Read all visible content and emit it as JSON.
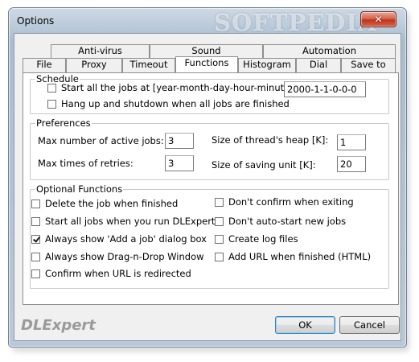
{
  "window": {
    "title": "Options",
    "watermark": "SOFTPEDIA"
  },
  "tabs": {
    "row1": [
      "Anti-virus",
      "Sound",
      "Automation"
    ],
    "row2": [
      "File",
      "Proxy",
      "Timeout",
      "Functions",
      "Histogram",
      "Dial",
      "Save to"
    ],
    "active": "Functions"
  },
  "schedule": {
    "legend": "Schedule",
    "start_label": "Start all the jobs at [year-month-day-hour-minute-second]:",
    "start_checked": false,
    "start_value": "2000-1-1-0-0-0",
    "hangup_label": "Hang up and shutdown when all jobs are finished",
    "hangup_checked": false
  },
  "preferences": {
    "legend": "Preferences",
    "max_active_label": "Max number of active jobs:",
    "max_active_value": "3",
    "max_retries_label": "Max times of retries:",
    "max_retries_value": "3",
    "heap_label": "Size of thread's heap [K]:",
    "heap_value": "1",
    "saving_unit_label": "Size of saving unit [K]:",
    "saving_unit_value": "20"
  },
  "optional": {
    "legend": "Optional Functions",
    "left": [
      {
        "label": "Delete the job when finished",
        "checked": false
      },
      {
        "label": "Start all jobs when you run DLExpert",
        "checked": false
      },
      {
        "label": "Always show 'Add a job' dialog box",
        "checked": true
      },
      {
        "label": "Always show Drag-n-Drop Window",
        "checked": false
      },
      {
        "label": "Confirm when URL is redirected",
        "checked": false
      }
    ],
    "right": [
      {
        "label": "Don't confirm when exiting",
        "checked": false
      },
      {
        "label": "Don't auto-start new jobs",
        "checked": false
      },
      {
        "label": "Create log files",
        "checked": false
      },
      {
        "label": "Add URL when finished (HTML)",
        "checked": false
      }
    ]
  },
  "footer": {
    "brand": "DLExpert",
    "ok_label": "OK",
    "cancel_label": "Cancel"
  }
}
